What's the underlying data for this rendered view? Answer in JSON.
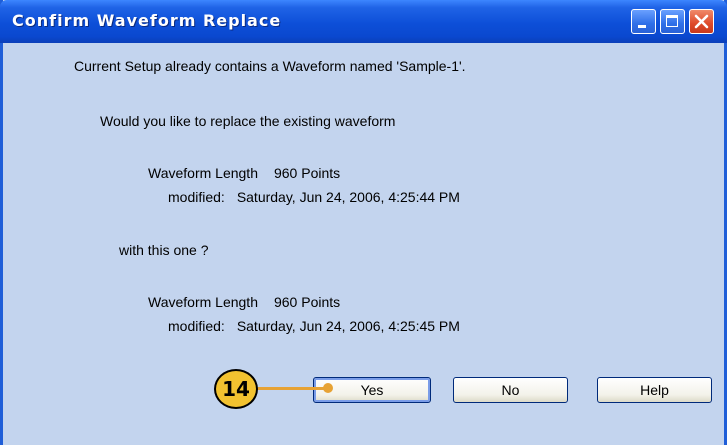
{
  "window": {
    "title": "Confirm Waveform Replace",
    "colors": {
      "titlebar": "#0d4fd8",
      "client": "#c3d4ee",
      "close": "#de4a2a"
    }
  },
  "message": {
    "line1": "Current Setup already contains a Waveform named 'Sample-1'.",
    "question": "Would you like to replace the existing waveform",
    "existing": {
      "length_label": "Waveform Length",
      "length_value": "960 Points",
      "modified_label": "modified:",
      "modified_value": "Saturday, Jun 24, 2006, 4:25:44 PM"
    },
    "with_this": "with this one ?",
    "new": {
      "length_label": "Waveform Length",
      "length_value": "960 Points",
      "modified_label": "modified:",
      "modified_value": "Saturday, Jun 24, 2006, 4:25:45 PM"
    }
  },
  "buttons": {
    "yes": "Yes",
    "no": "No",
    "help": "Help"
  },
  "callout": {
    "number": "14",
    "color": "#f2c230"
  },
  "icons": {
    "minimize": "minimize-icon",
    "maximize": "maximize-icon",
    "close": "close-icon"
  }
}
